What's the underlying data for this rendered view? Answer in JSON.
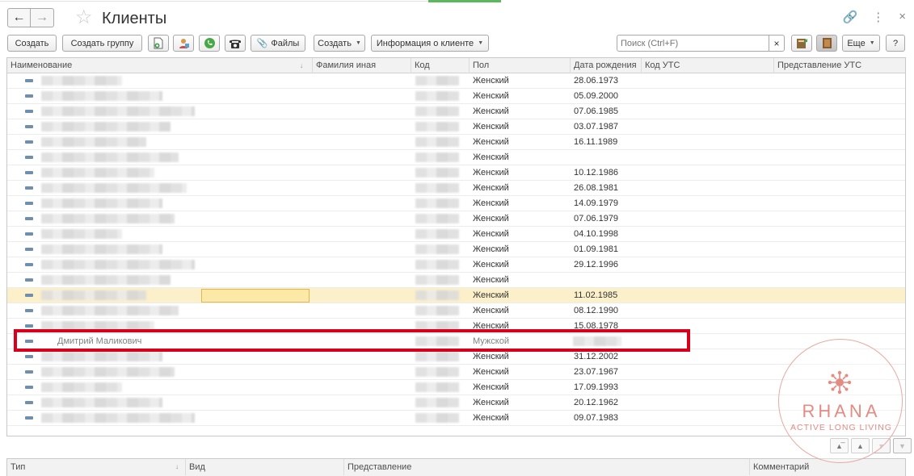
{
  "window": {
    "title": "Клиенты",
    "back_icon": "arrow-left-icon",
    "forward_icon": "arrow-right-icon",
    "favorite_icon": "star-icon",
    "link_icon": "link-icon",
    "more_icon": "more-vertical-icon",
    "close_icon": "close-icon"
  },
  "toolbar": {
    "create_label": "Создать",
    "create_group_label": "Создать группу",
    "files_label": "Файлы",
    "create_menu_label": "Создать",
    "client_info_label": "Информация о клиенте",
    "search_placeholder": "Поиск (Ctrl+F)",
    "search_clear": "×",
    "more_label": "Еще",
    "help_label": "?"
  },
  "grid": {
    "columns": [
      "Наименование",
      "Фамилия иная",
      "Код",
      "Пол",
      "Дата рождения",
      "Код УТС",
      "Представление УТС"
    ],
    "rows": [
      {
        "name": "",
        "gender": "Женский",
        "birth": "28.06.1973"
      },
      {
        "name": "",
        "gender": "Женский",
        "birth": "05.09.2000"
      },
      {
        "name": "",
        "gender": "Женский",
        "birth": "07.06.1985"
      },
      {
        "name": "",
        "gender": "Женский",
        "birth": "03.07.1987"
      },
      {
        "name": "",
        "gender": "Женский",
        "birth": "16.11.1989"
      },
      {
        "name": "",
        "gender": "Женский",
        "birth": ""
      },
      {
        "name": "",
        "gender": "Женский",
        "birth": "10.12.1986"
      },
      {
        "name": "",
        "gender": "Женский",
        "birth": "26.08.1981"
      },
      {
        "name": "",
        "gender": "Женский",
        "birth": "14.09.1979"
      },
      {
        "name": "",
        "gender": "Женский",
        "birth": "07.06.1979"
      },
      {
        "name": "",
        "gender": "Женский",
        "birth": "04.10.1998"
      },
      {
        "name": "",
        "gender": "Женский",
        "birth": "01.09.1981"
      },
      {
        "name": "",
        "gender": "Женский",
        "birth": "29.12.1996"
      },
      {
        "name": "",
        "gender": "Женский",
        "birth": ""
      },
      {
        "name": "",
        "gender": "Женский",
        "birth": "11.02.1985",
        "selected": true
      },
      {
        "name": "",
        "gender": "Женский",
        "birth": "08.12.1990"
      },
      {
        "name": "",
        "gender": "Женский",
        "birth": "15.08.1978"
      },
      {
        "name": "Дмитрий Маликович",
        "gender": "Мужской",
        "birth": "",
        "highlighted": true
      },
      {
        "name": "",
        "gender": "Женский",
        "birth": "31.12.2002"
      },
      {
        "name": "",
        "gender": "Женский",
        "birth": "23.07.1967"
      },
      {
        "name": "",
        "gender": "Женский",
        "birth": "17.09.1993"
      },
      {
        "name": "",
        "gender": "Женский",
        "birth": "20.12.1962"
      },
      {
        "name": "",
        "gender": "Женский",
        "birth": "09.07.1983"
      }
    ]
  },
  "contacts_grid": {
    "columns": [
      "Тип",
      "Вид",
      "Представление",
      "Комментарий"
    ]
  },
  "watermark": {
    "name": "RHANA",
    "tagline": "ACTIVE LONG LIVING"
  },
  "colors": {
    "highlight_border": "#d9001b",
    "selected_row": "#fbf0c9",
    "watermark": "#e38c83"
  }
}
